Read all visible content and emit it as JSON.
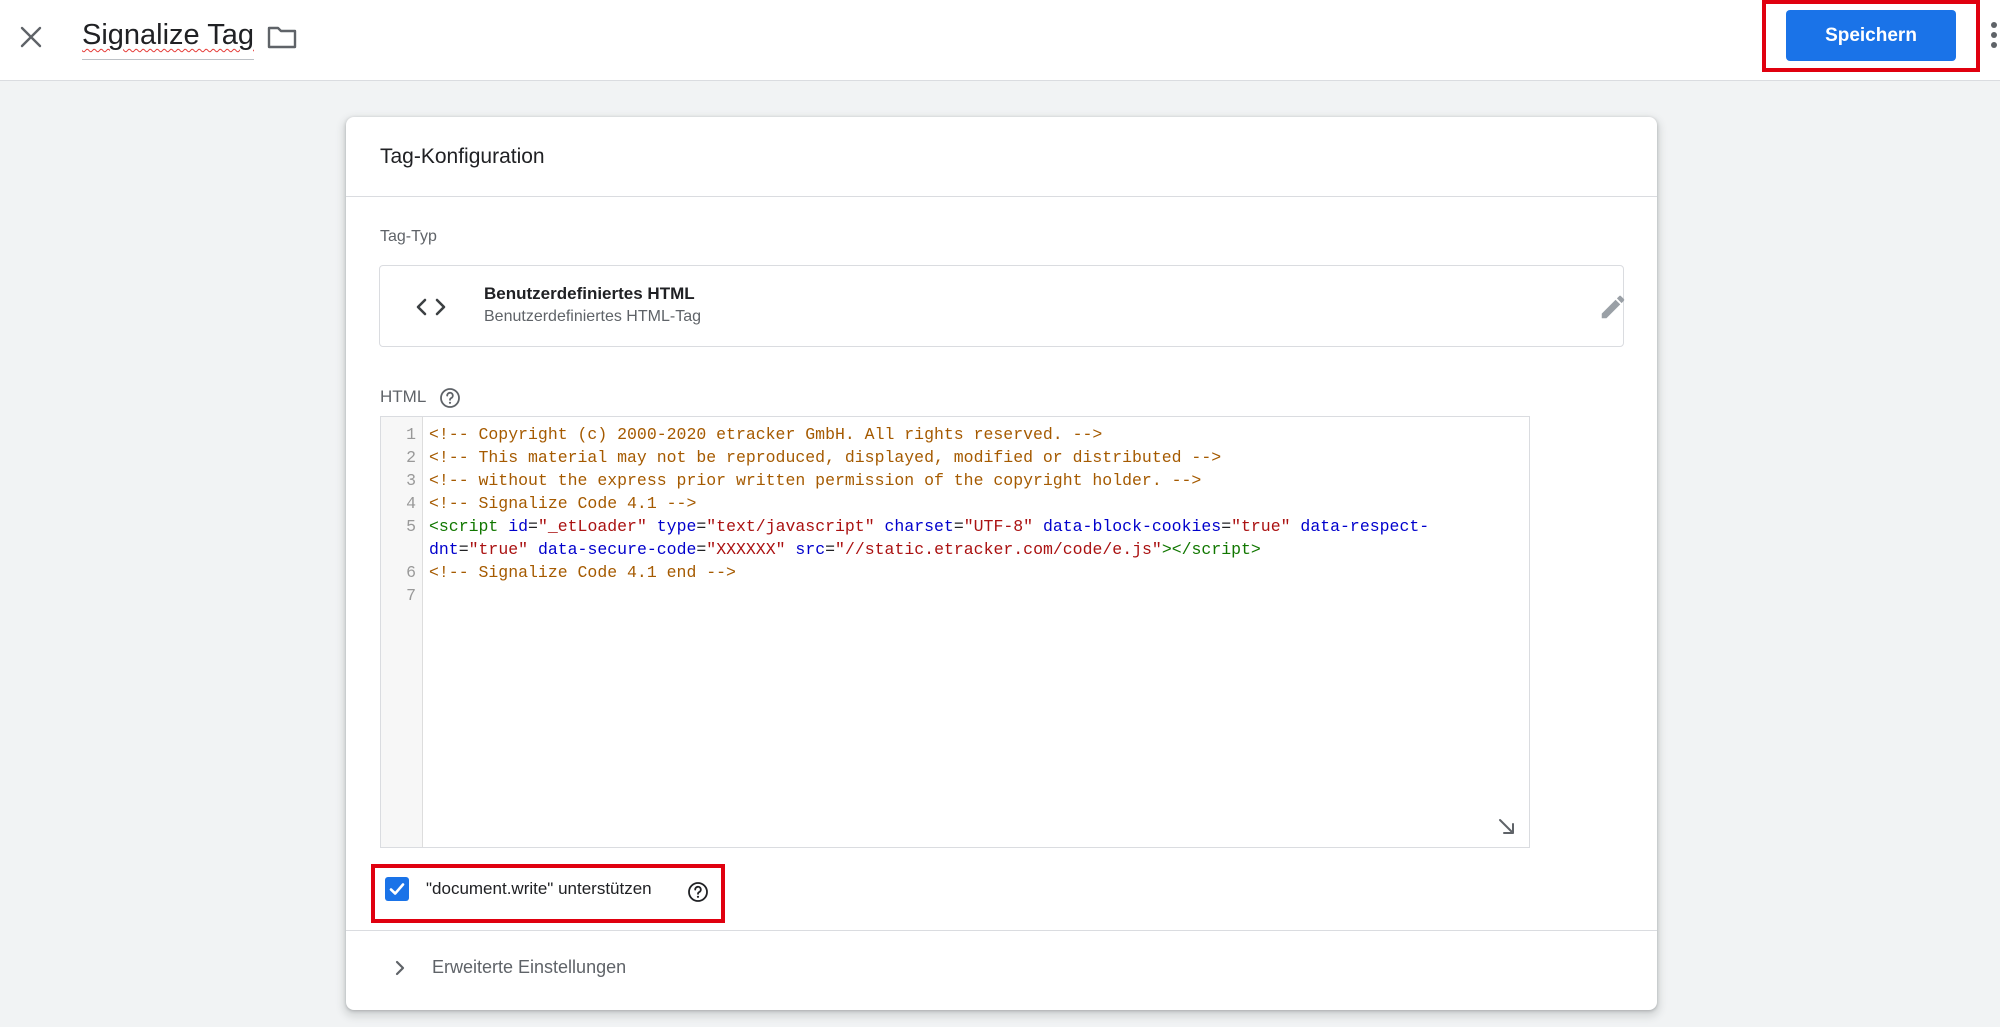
{
  "header": {
    "tag_name": "Signalize Tag",
    "save_label": "Speichern"
  },
  "card": {
    "title": "Tag-Konfiguration",
    "tag_type_label": "Tag-Typ",
    "tag_type": {
      "name": "Benutzerdefiniertes HTML",
      "description": "Benutzerdefiniertes HTML-Tag"
    },
    "html_label": "HTML",
    "editor": {
      "line_numbers": [
        "1",
        "2",
        "3",
        "4",
        "5",
        "6",
        "7"
      ],
      "lines": {
        "l1": "<!-- Copyright (c) 2000-2020 etracker GmbH. All rights reserved. -->",
        "l2": "<!-- This material may not be reproduced, displayed, modified or distributed -->",
        "l3": "<!-- without the express prior written permission of the copyright holder. -->",
        "l4": "<!-- Signalize Code 4.1 -->",
        "l5": {
          "t1": "<script",
          "a1": "id",
          "s1": "\"_etLoader\"",
          "a2": "type",
          "s2": "\"text/javascript\"",
          "a3": "charset",
          "s3": "\"UTF-8\"",
          "a4": "data-block-cookies",
          "s4": "\"true\"",
          "a5a": "data-respect-",
          "a5b": "dnt",
          "s5": "\"true\"",
          "a6": "data-secure-code",
          "s6": "\"XXXXXX\"",
          "a7": "src",
          "s7": "\"//static.etracker.com/code/e.js\"",
          "t2": "></script>"
        },
        "l6": "<!-- Signalize Code 4.1 end -->"
      }
    },
    "document_write": {
      "checked": true,
      "label": "\"document.write\" unterstützen"
    },
    "advanced_label": "Erweiterte Einstellungen"
  },
  "colors": {
    "accent": "#1a73e8",
    "highlight": "#e0000f"
  },
  "icons": [
    "close-icon",
    "folder-icon",
    "more-vert-icon",
    "code-icon",
    "edit-pencil-icon",
    "help-icon",
    "check-icon",
    "chevron-right-icon",
    "resize-icon"
  ]
}
